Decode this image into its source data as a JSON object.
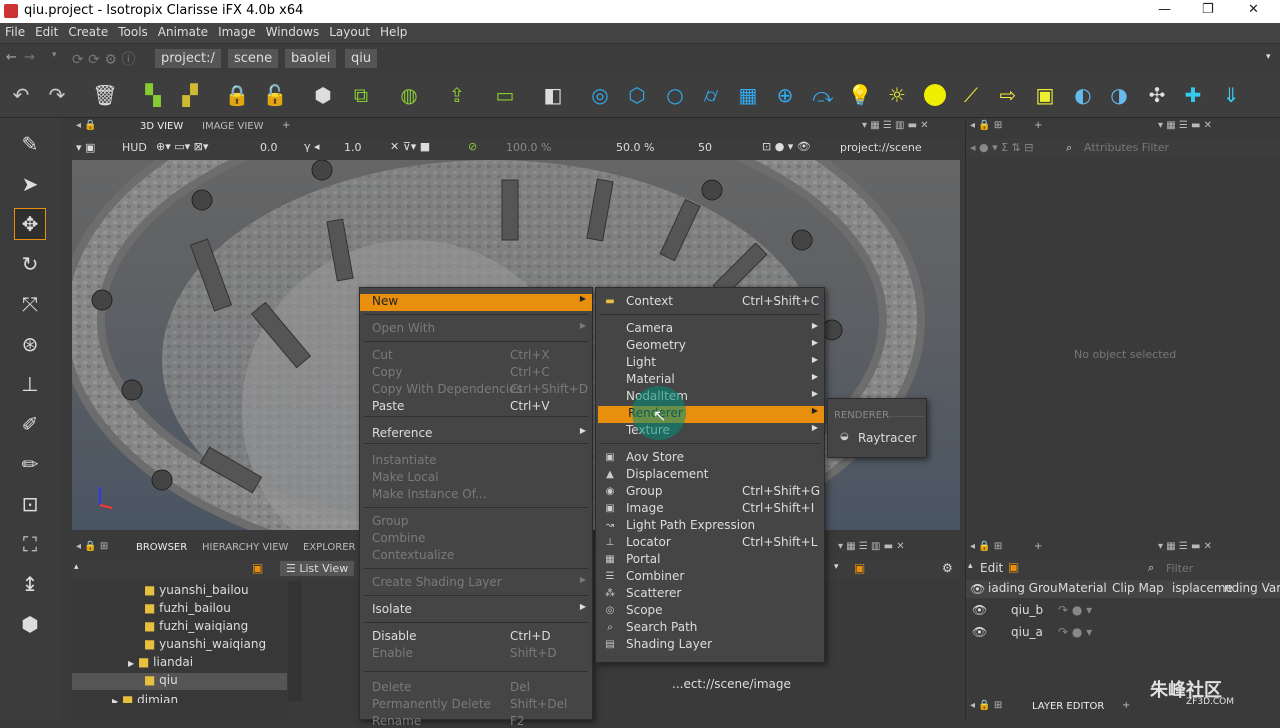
{
  "window": {
    "title": "qiu.project - Isotropix Clarisse iFX 4.0b x64",
    "minimize": "—",
    "restore": "❐",
    "close": "✕"
  },
  "menubar": [
    "File",
    "Edit",
    "Create",
    "Tools",
    "Animate",
    "Image",
    "Windows",
    "Layout",
    "Help"
  ],
  "address": {
    "crumbs": [
      "project:/",
      "scene",
      "baolei",
      "qiu"
    ]
  },
  "viewport": {
    "tabs": [
      "3D VIEW",
      "IMAGE VIEW"
    ],
    "hud": "HUD",
    "val1": "0.0",
    "val2": "1.0",
    "pct1": "100.0 %",
    "pct2": "50.0 %",
    "num": "50",
    "path": "project://scene"
  },
  "attributes": {
    "filter": "Attributes Filter",
    "empty": "No object selected"
  },
  "browser": {
    "tabs": [
      "BROWSER",
      "HIERARCHY VIEW",
      "EXPLORER"
    ],
    "listview": "List View",
    "items": [
      "yuanshi_bailou",
      "fuzhi_bailou",
      "fuzhi_waiqiang",
      "yuanshi_waiqiang",
      "liandai",
      "qiu",
      "dimian"
    ],
    "path": "...ect://scene/image"
  },
  "layer": {
    "edit": "Edit",
    "filter": "Filter",
    "cols": [
      "iading Grou",
      "Material",
      "Clip Map",
      "isplaceme",
      "nding Varia"
    ],
    "rows": [
      "qiu_b",
      "qiu_a"
    ],
    "title": "LAYER EDITOR"
  },
  "ctx": [
    {
      "l": "New",
      "s": "",
      "sel": true,
      "arr": true
    },
    {
      "l": "Open With",
      "s": "",
      "dis": true,
      "arr": true
    },
    {
      "l": "Cut",
      "s": "Ctrl+X",
      "dis": true
    },
    {
      "l": "Copy",
      "s": "Ctrl+C",
      "dis": true
    },
    {
      "l": "Copy With Dependencies",
      "s": "Ctrl+Shift+D",
      "dis": true
    },
    {
      "l": "Paste",
      "s": "Ctrl+V"
    },
    {
      "l": "Reference",
      "s": "",
      "arr": true
    },
    {
      "l": "Instantiate",
      "s": "",
      "dis": true
    },
    {
      "l": "Make Local",
      "s": "",
      "dis": true
    },
    {
      "l": "Make Instance Of...",
      "s": "",
      "dis": true
    },
    {
      "l": "Group",
      "s": "",
      "dis": true
    },
    {
      "l": "Combine",
      "s": "",
      "dis": true
    },
    {
      "l": "Contextualize",
      "s": "",
      "dis": true
    },
    {
      "l": "Create Shading Layer",
      "s": "",
      "dis": true,
      "arr": true
    },
    {
      "l": "Isolate",
      "s": "",
      "arr": true
    },
    {
      "l": "Disable",
      "s": "Ctrl+D"
    },
    {
      "l": "Enable",
      "s": "Shift+D",
      "dis": true
    },
    {
      "l": "Delete",
      "s": "Del",
      "dis": true
    },
    {
      "l": "Permanently Delete",
      "s": "Shift+Del",
      "dis": true
    },
    {
      "l": "Rename",
      "s": "F2",
      "dis": true
    }
  ],
  "sub": [
    {
      "l": "Context",
      "s": "Ctrl+Shift+C",
      "i": "▬"
    },
    {
      "l": "Camera",
      "s": "",
      "arr": true
    },
    {
      "l": "Geometry",
      "s": "",
      "arr": true
    },
    {
      "l": "Light",
      "s": "",
      "arr": true
    },
    {
      "l": "Material",
      "s": "",
      "arr": true
    },
    {
      "l": "NodalItem",
      "s": "",
      "arr": true
    },
    {
      "l": "Renderer",
      "s": "",
      "arr": true,
      "sel": true
    },
    {
      "l": "Texture",
      "s": "",
      "arr": true
    },
    {
      "l": "Aov Store",
      "s": "",
      "i": "▣"
    },
    {
      "l": "Displacement",
      "s": "",
      "i": "▲"
    },
    {
      "l": "Group",
      "s": "Ctrl+Shift+G",
      "i": "◉"
    },
    {
      "l": "Image",
      "s": "Ctrl+Shift+I",
      "i": "▣"
    },
    {
      "l": "Light Path Expression",
      "s": "",
      "i": "↝"
    },
    {
      "l": "Locator",
      "s": "Ctrl+Shift+L",
      "i": "⊥"
    },
    {
      "l": "Portal",
      "s": "",
      "i": "▦"
    },
    {
      "l": "Combiner",
      "s": "",
      "i": "☰"
    },
    {
      "l": "Scatterer",
      "s": "",
      "i": "⁂"
    },
    {
      "l": "Scope",
      "s": "",
      "i": "◎"
    },
    {
      "l": "Search Path",
      "s": "",
      "i": "⌕"
    },
    {
      "l": "Shading Layer",
      "s": "",
      "i": "▤"
    }
  ],
  "sub2": {
    "header": "RENDERER",
    "item": "Raytracer"
  },
  "watermark": {
    "main": "朱峰社区",
    "sub": "ZF3D.COM"
  }
}
